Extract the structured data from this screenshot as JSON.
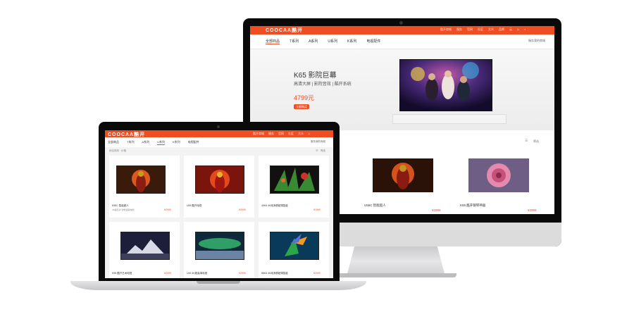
{
  "desktop": {
    "logo": "COOCAA酷开",
    "top_nav": [
      "酷开商城",
      "服务",
      "官网",
      "社区",
      "大众",
      "品牌",
      "云",
      "购物车",
      "搜索"
    ],
    "sub_nav": [
      "全部商品",
      "T系列",
      "A系列",
      "U系列",
      "K系列",
      "电视配件"
    ],
    "sub_nav_right": "服务我的商城",
    "hero": {
      "title": "K65 影院巨幕",
      "subtitle": "高清大屏 | 影院音效 | 酷开系统",
      "price": "4799元",
      "button": "立即购买"
    },
    "filter_label": "筛选",
    "products": [
      {
        "name": "U55C 智能超人",
        "sub": "",
        "price": "¥2999"
      },
      {
        "name": "K55 酷开钢琴神器",
        "sub": "",
        "price": "¥2999"
      }
    ]
  },
  "laptop": {
    "logo": "COOCAA酷开",
    "top_nav": [
      "酷开商城",
      "服务",
      "官网",
      "社区",
      "大众",
      "品牌",
      "购物车"
    ],
    "sub_nav": [
      "全部商品",
      "T系列",
      "A系列",
      "U系列",
      "K系列",
      "电视配件"
    ],
    "sub_nav_right": "服务我的商城",
    "sort_label": "综合排序 · 价格",
    "filter_label": "筛选",
    "products": [
      {
        "name": "K55C 智能超人",
        "sub": "4K超高清 智能语音电视",
        "price": "¥2999"
      },
      {
        "name": "U55 酷开电视",
        "sub": "",
        "price": "¥2999"
      },
      {
        "name": "40K6 4K纯净屏超薄智能",
        "sub": "",
        "price": "¥1999"
      },
      {
        "name": "K55 酷开艺术电视",
        "sub": "",
        "price": "¥2999"
      },
      {
        "name": "U49 4K超高清电视",
        "sub": "",
        "price": "¥2999"
      },
      {
        "name": "58K6 4K纯净屏超薄智能",
        "sub": "",
        "price": "¥2999"
      }
    ]
  },
  "colors": {
    "brand": "#ef4d22",
    "bezel": "#0a0a0a",
    "silver": "#d8d8da"
  }
}
